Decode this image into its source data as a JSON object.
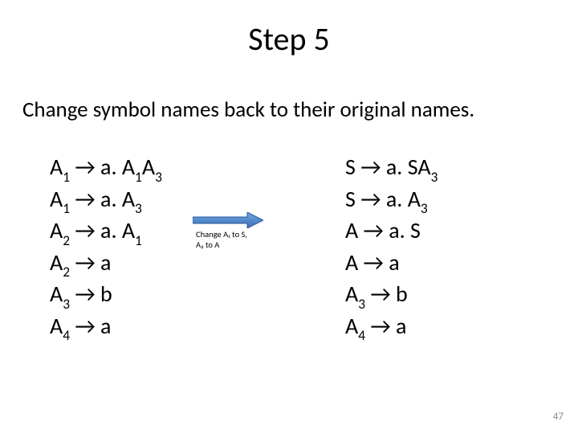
{
  "title": "Step 5",
  "subtitle": "Change symbol names back to their original names.",
  "arrow_label_line1": "Change A₁ to S,",
  "arrow_label_line2": "A₂ to A",
  "left_rules": [
    {
      "lhs": "A",
      "lhs_sub": "1",
      "rhs": [
        {
          "t": "a. A"
        },
        {
          "s": "1"
        },
        {
          "t": "A"
        },
        {
          "s": "3"
        }
      ]
    },
    {
      "lhs": "A",
      "lhs_sub": "1",
      "rhs": [
        {
          "t": "a. A"
        },
        {
          "s": "3"
        }
      ]
    },
    {
      "lhs": "A",
      "lhs_sub": "2",
      "rhs": [
        {
          "t": "a. A"
        },
        {
          "s": "1"
        }
      ]
    },
    {
      "lhs": "A",
      "lhs_sub": "2",
      "rhs": [
        {
          "t": "a"
        }
      ]
    },
    {
      "lhs": "A",
      "lhs_sub": "3",
      "rhs": [
        {
          "t": "b"
        }
      ]
    },
    {
      "lhs": "A",
      "lhs_sub": "4",
      "rhs": [
        {
          "t": "a"
        }
      ]
    }
  ],
  "right_rules": [
    {
      "lhs": "S",
      "lhs_sub": "",
      "rhs": [
        {
          "t": "a. SA"
        },
        {
          "s": "3"
        }
      ]
    },
    {
      "lhs": "S",
      "lhs_sub": "",
      "rhs": [
        {
          "t": "a. A"
        },
        {
          "s": "3"
        }
      ]
    },
    {
      "lhs": "A",
      "lhs_sub": "",
      "rhs": [
        {
          "t": "a. S"
        }
      ]
    },
    {
      "lhs": "A",
      "lhs_sub": "",
      "rhs": [
        {
          "t": "a"
        }
      ]
    },
    {
      "lhs": "A",
      "lhs_sub": "3",
      "rhs": [
        {
          "t": "b"
        }
      ]
    },
    {
      "lhs": "A",
      "lhs_sub": "4",
      "rhs": [
        {
          "t": "a"
        }
      ]
    }
  ],
  "page_number": "47"
}
